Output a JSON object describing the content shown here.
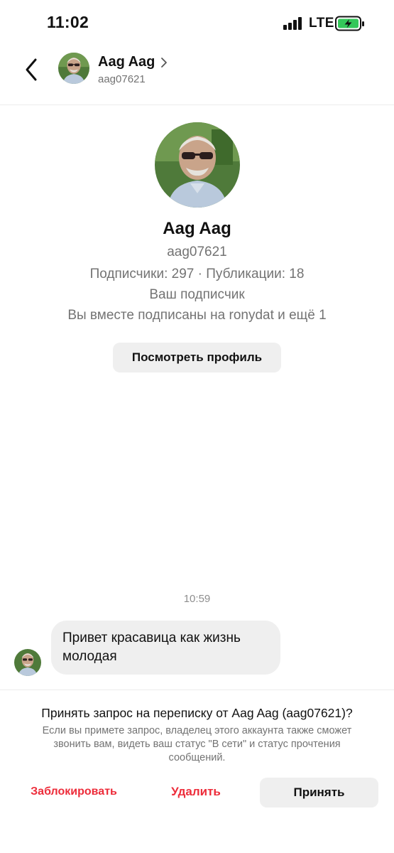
{
  "status_bar": {
    "time": "11:02",
    "network": "LTE",
    "icons": [
      "signal-icon",
      "battery-charging-icon"
    ]
  },
  "header": {
    "name": "Aag Aag",
    "username": "aag07621",
    "back_icon": "chevron-left-icon",
    "name_chevron_icon": "chevron-right-icon"
  },
  "profile": {
    "name": "Aag Aag",
    "username": "aag07621",
    "stats": "Подписчики: 297 · Публикации: 18",
    "follows_you": "Ваш подписчик",
    "mutual": "Вы вместе подписаны на ronydat и ещё 1",
    "view_profile_label": "Посмотреть профиль"
  },
  "conversation": {
    "timestamp": "10:59",
    "messages": [
      {
        "from": "Aag Aag",
        "text": "Привет красавица как жизнь молодая"
      }
    ]
  },
  "request": {
    "title": "Принять запрос на переписку от Aag Aag (aag07621)?",
    "description": "Если вы примете запрос, владелец этого аккаунта также сможет звонить вам, видеть ваш статус \"В сети\" и статус прочтения сообщений.",
    "block_label": "Заблокировать",
    "delete_label": "Удалить",
    "accept_label": "Принять"
  },
  "colors": {
    "danger": "#ed2c3a",
    "secondary_text": "#737373",
    "button_bg": "#efefef",
    "battery_charge": "#34c759"
  }
}
